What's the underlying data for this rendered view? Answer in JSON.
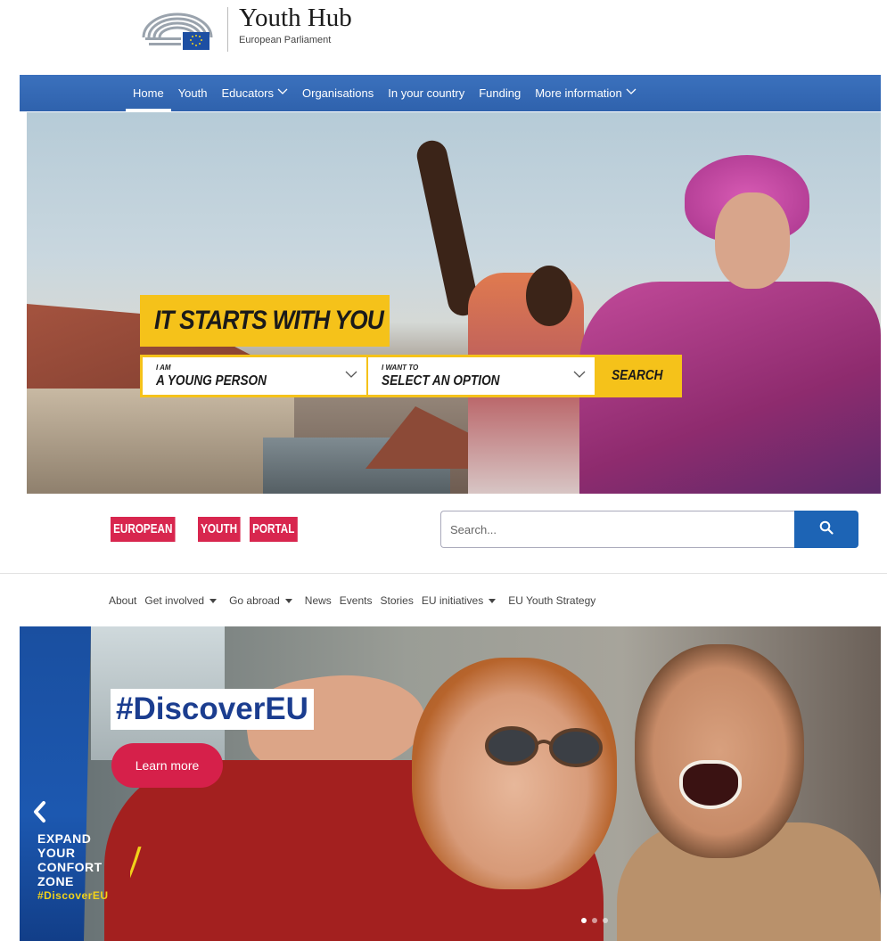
{
  "brand": {
    "title": "Youth Hub",
    "subtitle": "European Parliament"
  },
  "nav": {
    "items": [
      {
        "label": "Home",
        "active": true,
        "dropdown": false
      },
      {
        "label": "Youth",
        "active": false,
        "dropdown": false
      },
      {
        "label": "Educators",
        "active": false,
        "dropdown": true
      },
      {
        "label": "Organisations",
        "active": false,
        "dropdown": false
      },
      {
        "label": "In your country",
        "active": false,
        "dropdown": false
      },
      {
        "label": "Funding",
        "active": false,
        "dropdown": false
      },
      {
        "label": "More information",
        "active": false,
        "dropdown": true
      }
    ]
  },
  "hero": {
    "tagline": "IT STARTS WITH YOU",
    "finder": {
      "field1_label": "I AM",
      "field1_value": "A YOUNG PERSON",
      "field2_label": "I WANT TO",
      "field2_value": "SELECT AN OPTION",
      "search_label": "SEARCH"
    }
  },
  "portal": {
    "logo_words": [
      "EUROPEAN",
      "YOUTH",
      "PORTAL"
    ],
    "search_placeholder": "Search...",
    "search_icon": "search-icon"
  },
  "subnav": {
    "items": [
      {
        "label": "About",
        "dropdown": false
      },
      {
        "label": "Get involved",
        "dropdown": true
      },
      {
        "label": "Go abroad",
        "dropdown": true
      },
      {
        "label": "News",
        "dropdown": false
      },
      {
        "label": "Events",
        "dropdown": false
      },
      {
        "label": "Stories",
        "dropdown": false
      },
      {
        "label": "EU initiatives",
        "dropdown": true
      },
      {
        "label": "EU Youth Strategy",
        "dropdown": false
      }
    ]
  },
  "carousel": {
    "headline": "#DiscoverEU",
    "cta_label": "Learn more",
    "overlay_lines": [
      "EXPAND",
      "YOUR",
      "CONFORT",
      "ZONE"
    ],
    "overlay_hashtag": "#DiscoverEU",
    "slide_count": 3,
    "active_slide": 1
  },
  "colors": {
    "nav_blue": "#2f62ad",
    "hero_yellow": "#f5c21a",
    "portal_red": "#d8264e",
    "search_blue": "#1d64b5",
    "cta_red": "#d6204a",
    "discover_blue": "#1b3d8f"
  }
}
